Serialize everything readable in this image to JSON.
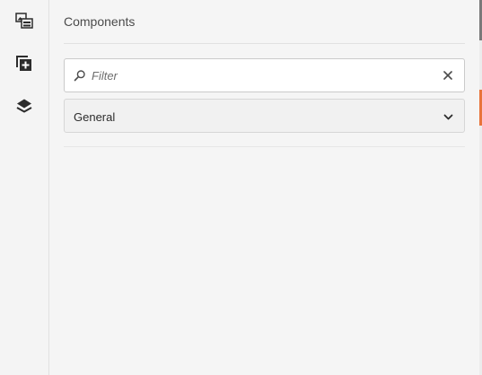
{
  "rail": {
    "items": [
      {
        "name": "assets-icon"
      },
      {
        "name": "components-icon"
      },
      {
        "name": "content-tree-icon"
      }
    ]
  },
  "panel": {
    "title": "Components",
    "filter": {
      "placeholder": "Filter",
      "value": ""
    },
    "group_select": {
      "selected": "General"
    }
  },
  "colors": {
    "accent": "#e8743b",
    "icon": "#2c2c2c",
    "background": "#f4f4f4"
  }
}
